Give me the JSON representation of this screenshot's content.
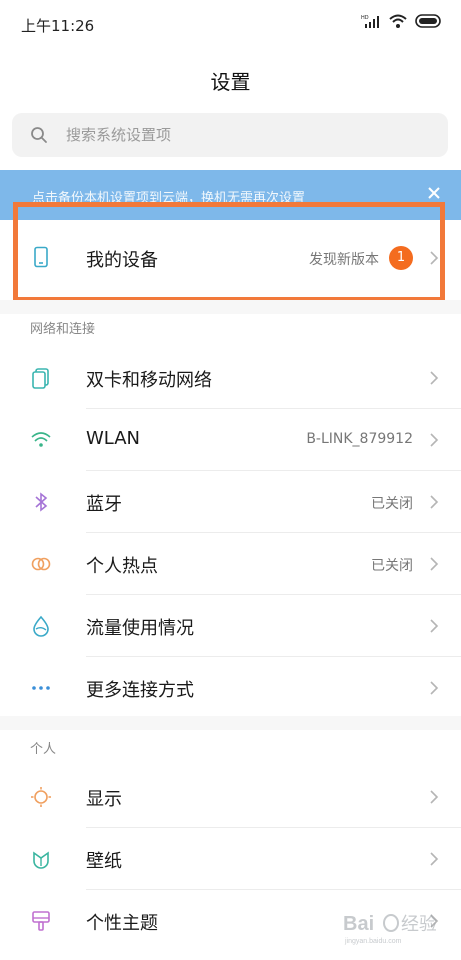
{
  "status": {
    "time": "上午11:26"
  },
  "header": {
    "title": "设置"
  },
  "search": {
    "placeholder": "搜索系统设置项"
  },
  "banner": {
    "text": "点击备份本机设置项到云端，换机无需再次设置"
  },
  "device": {
    "label": "我的设备",
    "value": "发现新版本",
    "badge": "1"
  },
  "network": {
    "title": "网络和连接",
    "items": [
      {
        "label": "双卡和移动网络",
        "value": "",
        "icon": "sim-cards-icon"
      },
      {
        "label": "WLAN",
        "value": "B-LINK_879912",
        "icon": "wifi-icon"
      },
      {
        "label": "蓝牙",
        "value": "已关闭",
        "icon": "bluetooth-icon"
      },
      {
        "label": "个人热点",
        "value": "已关闭",
        "icon": "hotspot-icon"
      },
      {
        "label": "流量使用情况",
        "value": "",
        "icon": "data-usage-icon"
      },
      {
        "label": "更多连接方式",
        "value": "",
        "icon": "more-dots-icon"
      }
    ]
  },
  "personal": {
    "title": "个人",
    "items": [
      {
        "label": "显示",
        "icon": "display-icon"
      },
      {
        "label": "壁纸",
        "icon": "wallpaper-icon"
      },
      {
        "label": "个性主题",
        "icon": "theme-icon"
      }
    ]
  },
  "colors": {
    "accent": "#f2793a",
    "banner": "#7eb8ea",
    "badge": "#f46c1f"
  }
}
